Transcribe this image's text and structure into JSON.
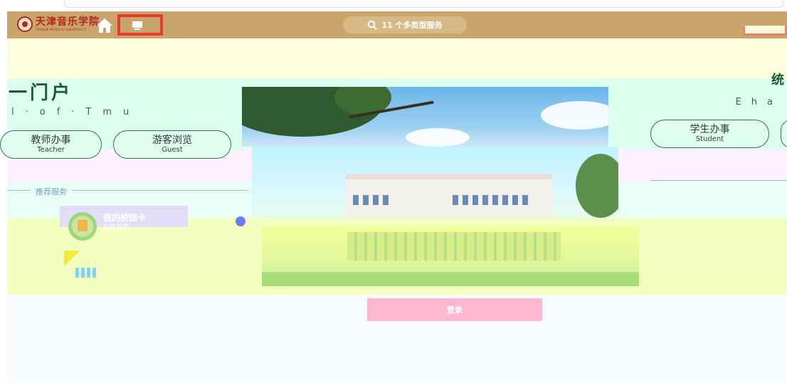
{
  "header": {
    "logo_text": "天津音乐学院",
    "logo_sub": "TIANJIN MUSICAL UNIVERSITY",
    "search_text": "11 个多类型服务"
  },
  "fragments": {
    "left_title": "一门户",
    "left_sub": "l·of·Tmu",
    "right_title": "统",
    "right_sub": "Eha"
  },
  "roles": {
    "teacher": {
      "cn": "教师办事",
      "en": "Teacher"
    },
    "guest": {
      "cn": "游客浏览",
      "en": "Guest"
    },
    "student": {
      "cn": "学生办事",
      "en": "Student"
    }
  },
  "section": {
    "label": "推荐服务"
  },
  "service_card": {
    "title": "我的校园卡",
    "subtitle": "在线服务"
  },
  "login": {
    "label": "登录"
  },
  "colors": {
    "header": "#c9a46b",
    "accent_red": "#e83a2e",
    "login": "#ffb6cf"
  }
}
